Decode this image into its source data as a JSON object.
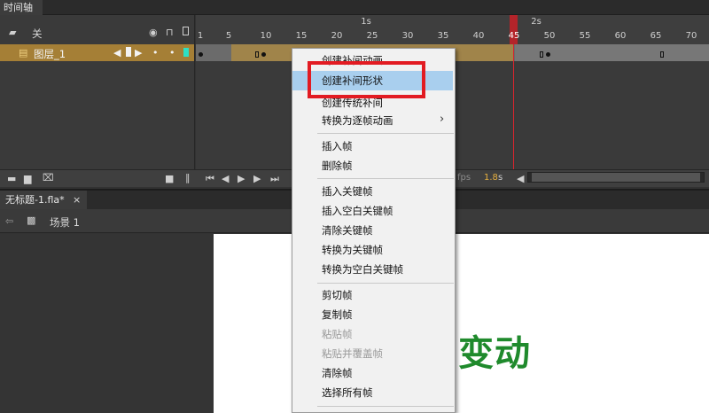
{
  "panel_tab": {
    "label": "时间轴"
  },
  "layer_header": {
    "outline_label": "关"
  },
  "ruler": {
    "second_marks": [
      "1s",
      "2s"
    ],
    "frame_labels": [
      "1",
      "5",
      "10",
      "15",
      "20",
      "25",
      "30",
      "35",
      "40",
      "45",
      "50",
      "55",
      "60",
      "65",
      "70"
    ],
    "current_frame": "45"
  },
  "layer": {
    "name": "图层_1"
  },
  "timeline_status": {
    "fps": "fps",
    "time": "1.8",
    "time_unit": "s"
  },
  "document_tab": {
    "title": "无标题-1.fla*",
    "close": "×"
  },
  "scene": {
    "label": "场景 1"
  },
  "stage": {
    "text": "变动"
  },
  "context_menu": {
    "items": [
      {
        "label": "创建补间动画",
        "disabled": false
      },
      {
        "label": "创建补间形状",
        "disabled": false,
        "highlighted": true
      },
      {
        "label": "创建传统补间",
        "disabled": false
      },
      {
        "label": "转换为逐帧动画",
        "disabled": false,
        "submenu_arrow": "›"
      },
      {
        "label": "插入帧",
        "disabled": false
      },
      {
        "label": "删除帧",
        "disabled": false
      },
      {
        "label": "插入关键帧",
        "disabled": false
      },
      {
        "label": "插入空白关键帧",
        "disabled": false
      },
      {
        "label": "清除关键帧",
        "disabled": false
      },
      {
        "label": "转换为关键帧",
        "disabled": false
      },
      {
        "label": "转换为空白关键帧",
        "disabled": false
      },
      {
        "label": "剪切帧",
        "disabled": false
      },
      {
        "label": "复制帧",
        "disabled": false
      },
      {
        "label": "粘贴帧",
        "disabled": true
      },
      {
        "label": "粘贴并覆盖帧",
        "disabled": true
      },
      {
        "label": "清除帧",
        "disabled": false
      },
      {
        "label": "选择所有帧",
        "disabled": false
      }
    ]
  },
  "colors": {
    "highlight": "#a9cfee",
    "annotation_box": "#e21b22",
    "playhead": "#d6252e",
    "layer_active": "#a57f36",
    "stage_text": "#1f8a2c"
  }
}
